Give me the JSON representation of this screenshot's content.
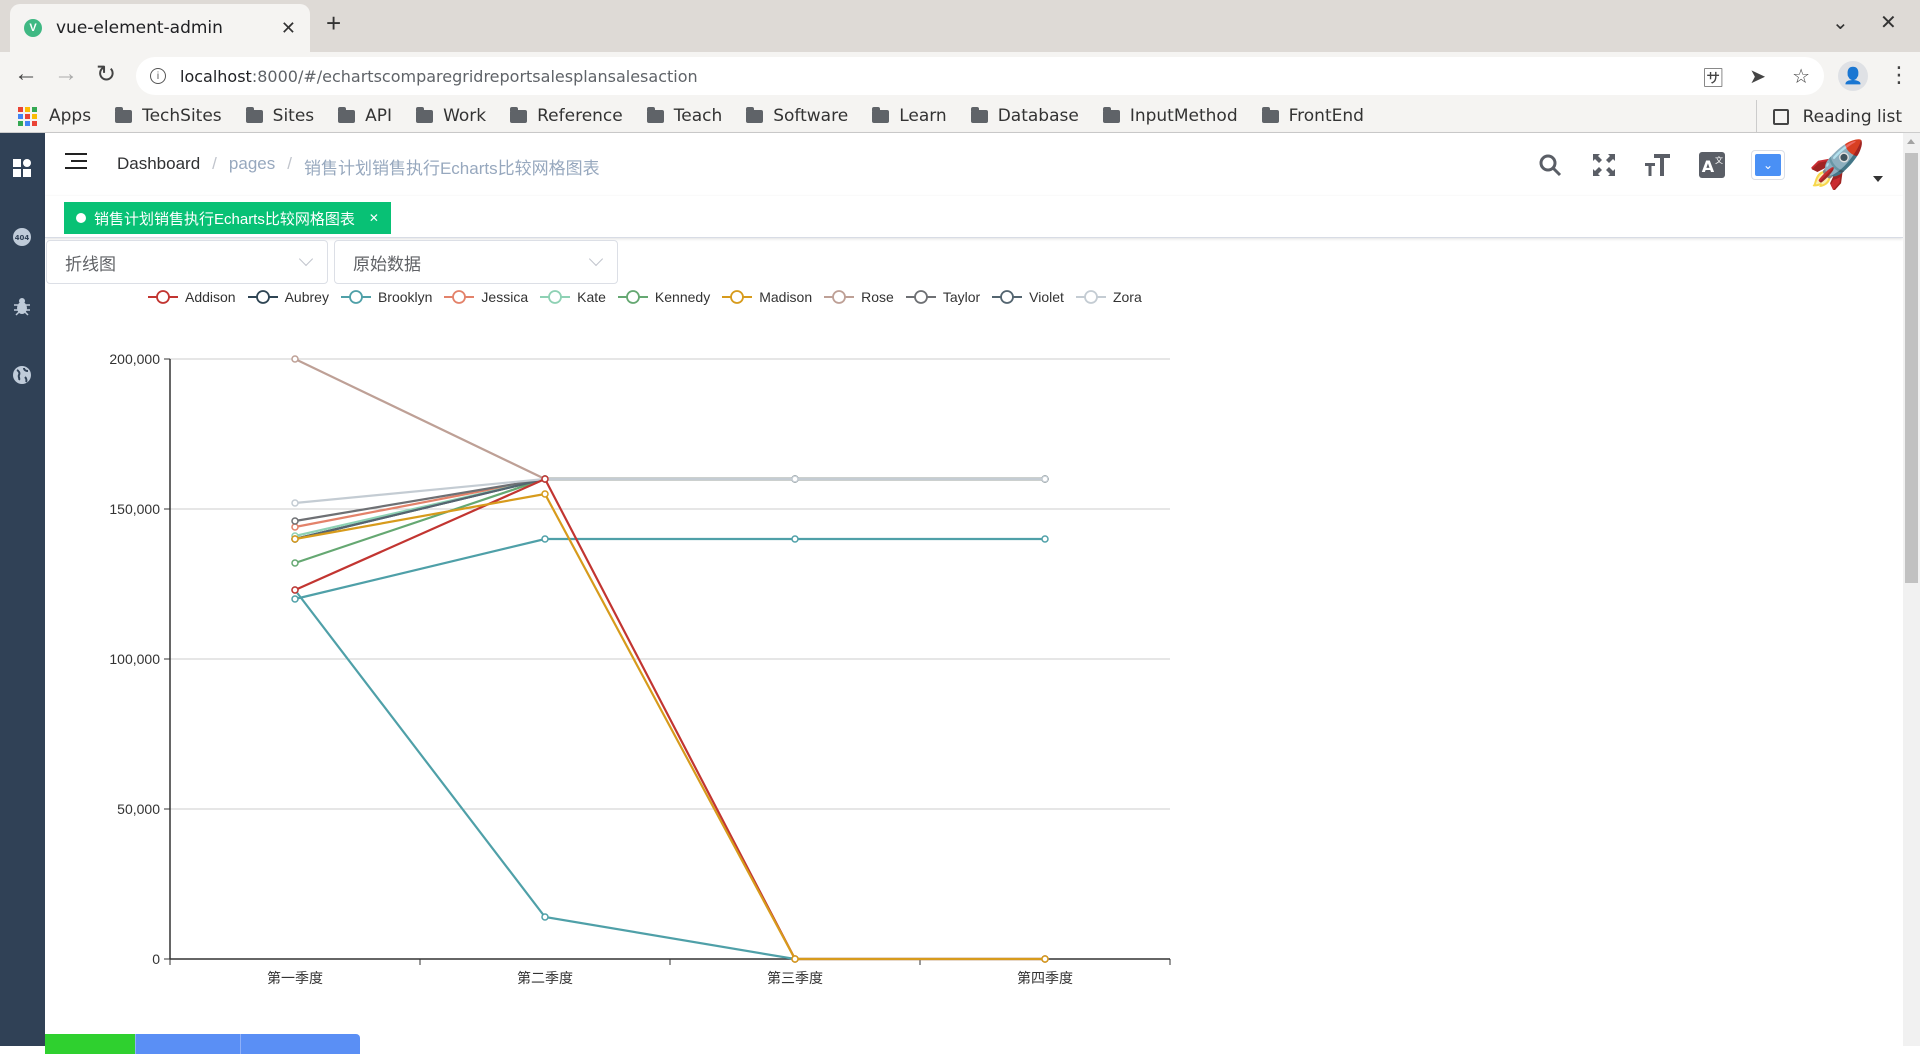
{
  "browser": {
    "tab_title": "vue-element-admin",
    "tab_favicon": "V",
    "url_host": "localhost",
    "url_rest": ":8000/#/echartscomparegridreportsalesplansalesaction",
    "bookmarks": [
      "Apps",
      "TechSites",
      "Sites",
      "API",
      "Work",
      "Reference",
      "Teach",
      "Software",
      "Learn",
      "Database",
      "InputMethod",
      "FrontEnd"
    ],
    "reading_list": "Reading list"
  },
  "navbar": {
    "breadcrumb": [
      "Dashboard",
      "pages",
      "销售计划销售执行Echarts比较网格图表"
    ],
    "tools": [
      "search-icon",
      "fullscreen-icon",
      "text-size-icon",
      "translate-icon",
      "size-select",
      "avatar-rocket"
    ]
  },
  "tags": [
    {
      "label": "销售计划销售执行Echarts比较网格图表",
      "active": true
    }
  ],
  "filters": {
    "chart_type": "折线图",
    "data_mode": "原始数据"
  },
  "colors": {
    "sidebar": "#304156",
    "tag_active": "#08c175",
    "primary": "#4a90f5"
  },
  "bottom_buttons": [
    "",
    "",
    ""
  ],
  "chart_data": {
    "type": "line",
    "title": "",
    "xlabel": "",
    "ylabel": "",
    "categories": [
      "第一季度",
      "第二季度",
      "第三季度",
      "第四季度"
    ],
    "ylim": [
      0,
      200000
    ],
    "yticks": [
      "0",
      "50,000",
      "100,000",
      "150,000",
      "200,000"
    ],
    "grid": true,
    "legend_position": "top-left",
    "series": [
      {
        "name": "Addison",
        "color": "#c23531",
        "values": [
          123000,
          160000,
          0,
          0
        ]
      },
      {
        "name": "Aubrey",
        "color": "#2f4554",
        "values": [
          140000,
          160000,
          160000,
          160000
        ]
      },
      {
        "name": "Brooklyn",
        "color": "#4fa0a8",
        "values": [
          120000,
          140000,
          140000,
          140000
        ]
      },
      {
        "name": "Jessica",
        "color": "#e3826a",
        "values": [
          144000,
          160000,
          160000,
          160000
        ]
      },
      {
        "name": "Kate",
        "color": "#8ed1b4",
        "values": [
          141000,
          160000,
          160000,
          160000
        ]
      },
      {
        "name": "Kennedy",
        "color": "#65a872",
        "values": [
          132000,
          160000,
          160000,
          160000
        ]
      },
      {
        "name": "Madison",
        "color": "#d79b1c",
        "values": [
          140000,
          155000,
          0,
          0
        ]
      },
      {
        "name": "Rose",
        "color": "#bea096",
        "values": [
          200000,
          160000,
          160000,
          160000
        ]
      },
      {
        "name": "Taylor",
        "color": "#6e7074",
        "values": [
          146000,
          160000,
          160000,
          160000
        ]
      },
      {
        "name": "Violet",
        "color": "#546570",
        "values": [
          140000,
          160000,
          160000,
          160000
        ]
      },
      {
        "name": "Zora",
        "color": "#c4ccd3",
        "values": [
          152000,
          160000,
          160000,
          160000
        ]
      }
    ],
    "unlabeled_series": [
      {
        "color": "#4fa0a8",
        "values": [
          123000,
          14000,
          0,
          0
        ]
      }
    ]
  }
}
